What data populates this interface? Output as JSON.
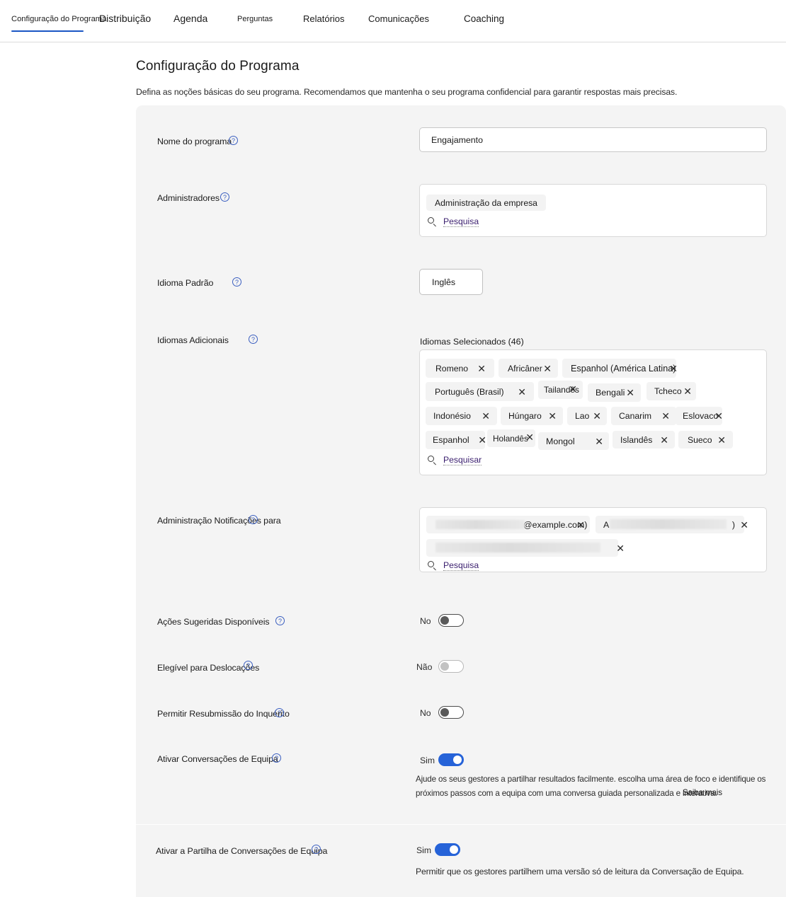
{
  "tabs": [
    {
      "label": "Configuração do Programa",
      "active": true
    },
    {
      "label": "Distribuição",
      "active": false
    },
    {
      "label": "Agenda",
      "active": false
    },
    {
      "label": "Perguntas",
      "active": false
    },
    {
      "label": "Relatórios",
      "active": false
    },
    {
      "label": "Comunicações",
      "active": false
    },
    {
      "label": "Coaching",
      "active": false
    }
  ],
  "page": {
    "title": "Configuração do Programa",
    "subtitle": "Defina as noções básicas do seu programa. Recomendamos que mantenha o seu programa confidencial para garantir respostas mais precisas."
  },
  "fields": {
    "program_name": {
      "label": "Nome do programa",
      "help_icon": "help-circle-icon",
      "value": "Engajamento"
    },
    "administrators": {
      "label": "Administradores",
      "help_icon": "help-circle-icon",
      "chips": [
        "Administração da empresa"
      ],
      "search_placeholder": "Pesquisa"
    },
    "default_language": {
      "label": "Idioma Padrão",
      "help_icon": "help-circle-icon",
      "value": "Inglês"
    },
    "additional_languages": {
      "label": "Idiomas Adicionais",
      "help_icon": "help-circle-icon",
      "selected_header": "Idiomas Selecionados (46)",
      "chips": [
        "Romeno",
        "Africâner",
        "Espanhol (América Latina)",
        "Português (Brasil)",
        "Tailandês",
        "Bengali",
        "Tcheco",
        "Indonésio",
        "Húngaro",
        "Lao",
        "Canarim",
        "Eslovaco",
        "Espanhol",
        "Holandês",
        "Mongol",
        "Islandês",
        "Sueco"
      ],
      "search_placeholder": "Pesquisar"
    },
    "admin_notifications": {
      "label": "Administração Notificações para",
      "help_icon": "help-circle-icon",
      "chips": [
        {
          "text": "@example.com)",
          "redacted": true
        },
        {
          "text": "A",
          "suffix": ")",
          "redacted": true
        },
        {
          "text": "",
          "redacted": true
        }
      ],
      "search_placeholder": "Pesquisa"
    },
    "suggested_actions": {
      "label": "Ações Sugeridas Disponíveis",
      "help_icon": "help-circle-icon",
      "state_text": "No",
      "state": "off"
    },
    "commute_eligible": {
      "label": "Elegível para Deslocações",
      "help_icon": "help-circle-icon",
      "state_text": "Não",
      "state": "disabled"
    },
    "allow_resubmission": {
      "label": "Permitir Resubmissão do Inquérito",
      "help_icon": "help-circle-icon",
      "state_text": "No",
      "state": "off"
    },
    "team_conversations": {
      "label": "Ativar Conversações de Equipa",
      "help_icon": "help-circle-icon",
      "state_text": "Sim",
      "state": "on",
      "description_line1": "Ajude os seus gestores a partilhar resultados facilmente. escolha uma área de foco e identifique os",
      "description_line2": "próximos passos com a equipa com uma conversa guiada personalizada e interativa.",
      "learn_more": "Saiba mais"
    },
    "team_conversation_sharing": {
      "label": "Ativar a Partilha de Conversações de Equipa",
      "help_icon": "help-circle-icon",
      "state_text": "Sim",
      "state": "on",
      "description_line1": "Permitir que os gestores partilhem uma versão só de leitura da Conversação de Equipa."
    }
  },
  "colors": {
    "accent": "#2663d8",
    "tab_underline": "#1a56c4",
    "card_bg": "#f4f4f4",
    "help_icon": "#3b5fc0"
  }
}
